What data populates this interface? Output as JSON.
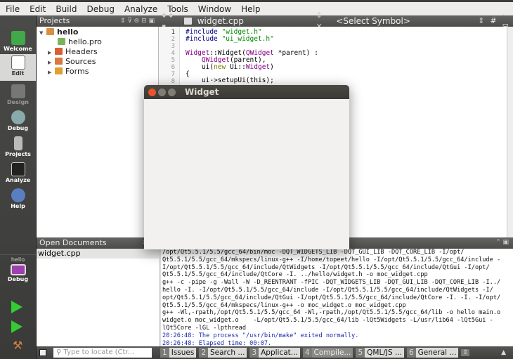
{
  "menu": [
    "File",
    "Edit",
    "Build",
    "Debug",
    "Analyze",
    "Tools",
    "Window",
    "Help"
  ],
  "modes": [
    {
      "label": "Welcome",
      "icon": "qt-logo-icon"
    },
    {
      "label": "Edit",
      "icon": "edit-document-icon"
    },
    {
      "label": "Design",
      "icon": "design-pen-icon"
    },
    {
      "label": "Debug",
      "icon": "debug-bug-icon"
    },
    {
      "label": "Projects",
      "icon": "projects-icon"
    },
    {
      "label": "Analyze",
      "icon": "analyze-monitor-icon"
    },
    {
      "label": "Help",
      "icon": "help-icon"
    }
  ],
  "kit": {
    "project": "hello",
    "mode": "Debug"
  },
  "projects": {
    "title": "Projects",
    "tree": [
      "hello",
      "hello.pro",
      "Headers",
      "Sources",
      "Forms"
    ]
  },
  "editor": {
    "file": "widget.cpp",
    "symbol": "<Select Symbol>",
    "hash": "#",
    "lines": [
      "1",
      "2",
      "3",
      "4",
      "5",
      "6",
      "7",
      "8"
    ]
  },
  "code": {
    "l1a": "#include ",
    "l1b": "\"widget.h\"",
    "l2a": "#include ",
    "l2b": "\"ui_widget.h\"",
    "l4a": "Widget",
    "l4b": "::",
    "l4c": "Widget",
    "l4d": "(",
    "l4e": "QWidget",
    "l4f": " *parent) :",
    "l5a": "    ",
    "l5b": "QWidget",
    "l5c": "(parent),",
    "l6a": "    ui(",
    "l6b": "new",
    "l6c": " Ui::",
    "l6d": "Widget",
    "l6e": ")",
    "l7": "{",
    "l8": "    ui->setupUi(this);"
  },
  "open_documents": {
    "title": "Open Documents",
    "items": [
      "widget.cpp"
    ]
  },
  "output": [
    "/opt/Qt5.5.1/5.5/gcc_64/bin/moc -DQT_WIDGETS_LIB -DQT_GUI_LIB -DQT_CORE_LIB -I/opt/",
    "Qt5.5.1/5.5/gcc_64/mkspecs/linux-g++ -I/home/topeet/hello -I/opt/Qt5.5.1/5.5/gcc_64/include -",
    "I/opt/Qt5.5.1/5.5/gcc_64/include/QtWidgets -I/opt/Qt5.5.1/5.5/gcc_64/include/QtGui -I/opt/",
    "Qt5.5.1/5.5/gcc_64/include/QtCore -I. ../hello/widget.h -o moc_widget.cpp",
    "g++ -c -pipe -g -Wall -W -D_REENTRANT -fPIC -DQT_WIDGETS_LIB -DQT_GUI_LIB -DQT_CORE_LIB -I../",
    "hello -I. -I/opt/Qt5.5.1/5.5/gcc_64/include -I/opt/Qt5.5.1/5.5/gcc_64/include/QtWidgets -I/",
    "opt/Qt5.5.1/5.5/gcc_64/include/QtGui -I/opt/Qt5.5.1/5.5/gcc_64/include/QtCore -I. -I. -I/opt/",
    "Qt5.5.1/5.5/gcc_64/mkspecs/linux-g++ -o moc_widget.o moc_widget.cpp",
    "g++ -Wl,-rpath,/opt/Qt5.5.1/5.5/gcc_64 -Wl,-rpath,/opt/Qt5.5.1/5.5/gcc_64/lib -o hello main.o",
    "widget.o moc_widget.o    -L/opt/Qt5.5.1/5.5/gcc_64/lib -lQt5Widgets -L/usr/lib64 -lQt5Gui -",
    "lQt5Core -lGL -lpthread",
    "20:26:48: The process \"/usr/bin/make\" exited normally.",
    "20:26:48: Elapsed time: 00:07."
  ],
  "bottom": {
    "locate_placeholder": "Type to locate (Ctr...",
    "tabs": [
      {
        "n": "1",
        "l": "Issues"
      },
      {
        "n": "2",
        "l": "Search ..."
      },
      {
        "n": "3",
        "l": "Applicat..."
      },
      {
        "n": "4",
        "l": "Compile..."
      },
      {
        "n": "5",
        "l": "QML/JS ..."
      },
      {
        "n": "6",
        "l": "General ..."
      }
    ]
  },
  "widget_window": {
    "title": "Widget"
  }
}
